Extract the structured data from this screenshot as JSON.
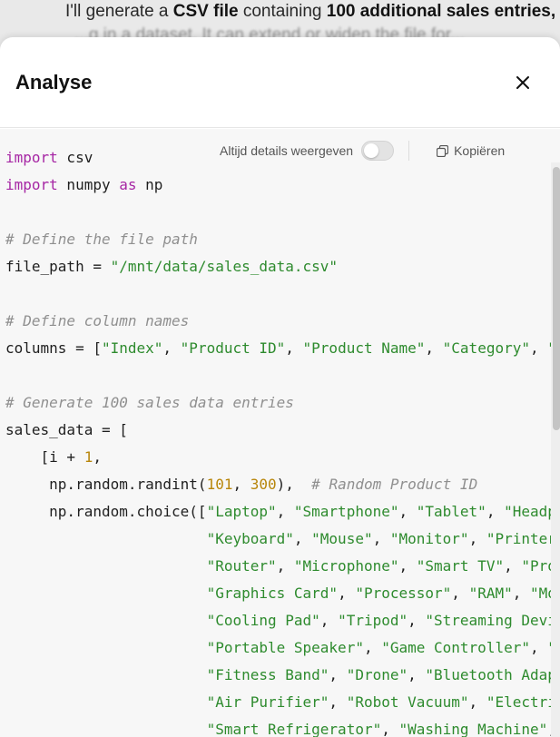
{
  "background_message": {
    "prefix": "I'll generate a ",
    "bold1": "CSV file",
    "middle": " containing ",
    "bold2": "100 additional sales entries,",
    "line2": "...g in a dataset. It can extend or widen the file for..."
  },
  "panel": {
    "title": "Analyse",
    "close_icon": "close-icon"
  },
  "toolbar": {
    "toggle_label": "Altijd details weergeven",
    "toggle_on": false,
    "copy_label": "Kopiëren",
    "copy_icon": "copy-icon"
  },
  "code": {
    "language": "python",
    "lines": [
      "import csv",
      "import numpy as np",
      "",
      "# Define the file path",
      "file_path = \"/mnt/data/sales_data.csv\"",
      "",
      "# Define column names",
      "columns = [\"Index\", \"Product ID\", \"Product Name\", \"Category\", \"",
      "",
      "# Generate 100 sales data entries",
      "sales_data = [",
      "    [i + 1,",
      "     np.random.randint(101, 300),  # Random Product ID",
      "     np.random.choice([\"Laptop\", \"Smartphone\", \"Tablet\", \"Headp",
      "                       \"Keyboard\", \"Mouse\", \"Monitor\", \"Printer",
      "                       \"Router\", \"Microphone\", \"Smart TV\", \"Pro",
      "                       \"Graphics Card\", \"Processor\", \"RAM\", \"Mo",
      "                       \"Cooling Pad\", \"Tripod\", \"Streaming Devi",
      "                       \"Portable Speaker\", \"Game Controller\", \"",
      "                       \"Fitness Band\", \"Drone\", \"Bluetooth Adap",
      "                       \"Air Purifier\", \"Robot Vacuum\", \"Electri",
      "                       \"Smart Refrigerator\", \"Washing Machine\","
    ]
  },
  "colors": {
    "keyword": "#a626a4",
    "string": "#2e8b2e",
    "number": "#b8860b",
    "comment": "#8f8f8f"
  }
}
